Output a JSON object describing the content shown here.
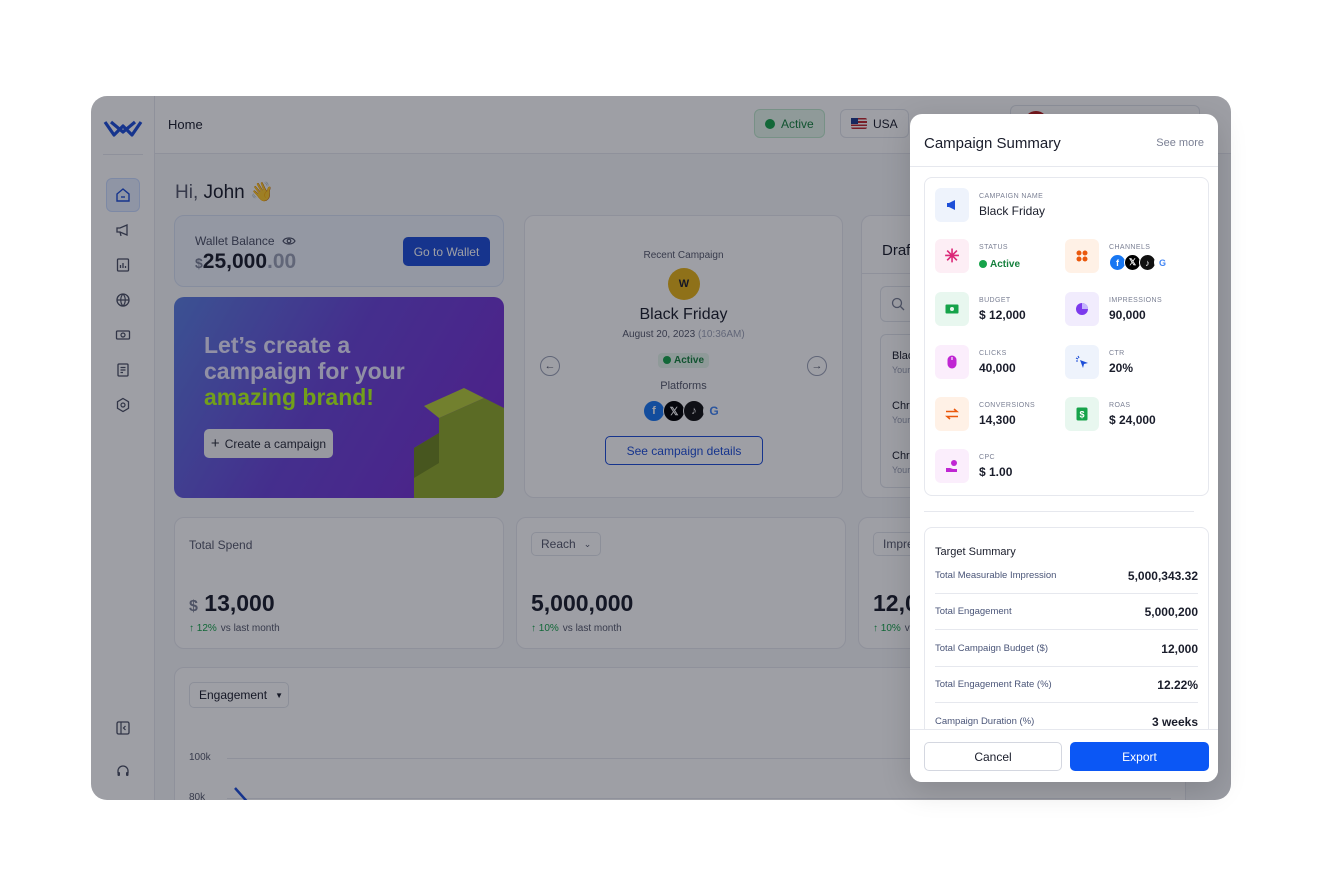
{
  "topbar": {
    "breadcrumb": "Home",
    "status": "Active",
    "country": "USA"
  },
  "greeting": {
    "hi": "Hi,",
    "name": "John",
    "emoji": "👋"
  },
  "wallet": {
    "label": "Wallet Balance",
    "currency": "$",
    "amount": "25,000",
    "decimals": ".00",
    "button": "Go to Wallet"
  },
  "promo": {
    "line1": "Let’s create a",
    "line2": "campaign for your",
    "line3": "amazing brand!",
    "button": "Create a campaign"
  },
  "recent": {
    "label": "Recent Campaign",
    "logo_text": "W",
    "name": "Black Friday",
    "date": "August 20, 2023",
    "time": "(10:36AM)",
    "status": "Active",
    "platforms_label": "Platforms",
    "button": "See campaign details"
  },
  "drafts": {
    "title": "Draf",
    "items": [
      {
        "name": "Blac",
        "sub": "Your"
      },
      {
        "name": "Chr",
        "sub": "Your"
      },
      {
        "name": "Chr",
        "sub": "Your"
      }
    ]
  },
  "stats": [
    {
      "label": "Total Spend",
      "currency": "$",
      "value": "13,000",
      "delta": "12%",
      "delta_text": "vs last month"
    },
    {
      "label": "Reach",
      "value": "5,000,000",
      "delta": "10%",
      "delta_text": "vs last month"
    },
    {
      "label": "Impre",
      "value": "12,0",
      "delta": "10%",
      "delta_text": "vs"
    }
  ],
  "chart": {
    "dropdown": "Engagement",
    "y_ticks": [
      "100k",
      "80k"
    ]
  },
  "panel": {
    "title": "Campaign Summary",
    "see_more": "See more",
    "campaign_name_label": "CAMPAIGN NAME",
    "campaign_name": "Black Friday",
    "metrics": [
      {
        "label": "STATUS",
        "value": "Active"
      },
      {
        "label": "CHANNELS",
        "value": ""
      },
      {
        "label": "BUDGET",
        "value": "$ 12,000"
      },
      {
        "label": "IMPRESSIONS",
        "value": "90,000"
      },
      {
        "label": "CLICKS",
        "value": "40,000"
      },
      {
        "label": "CTR",
        "value": "20%"
      },
      {
        "label": "CONVERSIONS",
        "value": "14,300"
      },
      {
        "label": "ROAS",
        "value": "$ 24,000"
      },
      {
        "label": "CPC",
        "value": "$ 1.00"
      }
    ],
    "target_title": "Target Summary",
    "target_rows": [
      {
        "k": "Total Measurable Impression",
        "v": "5,000,343.32"
      },
      {
        "k": "Total Engagement",
        "v": "5,000,200"
      },
      {
        "k": "Total Campaign Budget ($)",
        "v": "12,000"
      },
      {
        "k": "Total Engagement Rate (%)",
        "v": "12.22%"
      },
      {
        "k": "Campaign Duration (%)",
        "v": "3 weeks"
      }
    ],
    "cancel": "Cancel",
    "export": "Export"
  },
  "colors": {
    "primary": "#1d4ed8",
    "export": "#0b57f5",
    "success": "#16a34a",
    "accent_lime": "#b6ff1a"
  },
  "social_icons": {
    "fb": "f",
    "x": "𝕏",
    "tiktok": "♪",
    "google": "G"
  }
}
